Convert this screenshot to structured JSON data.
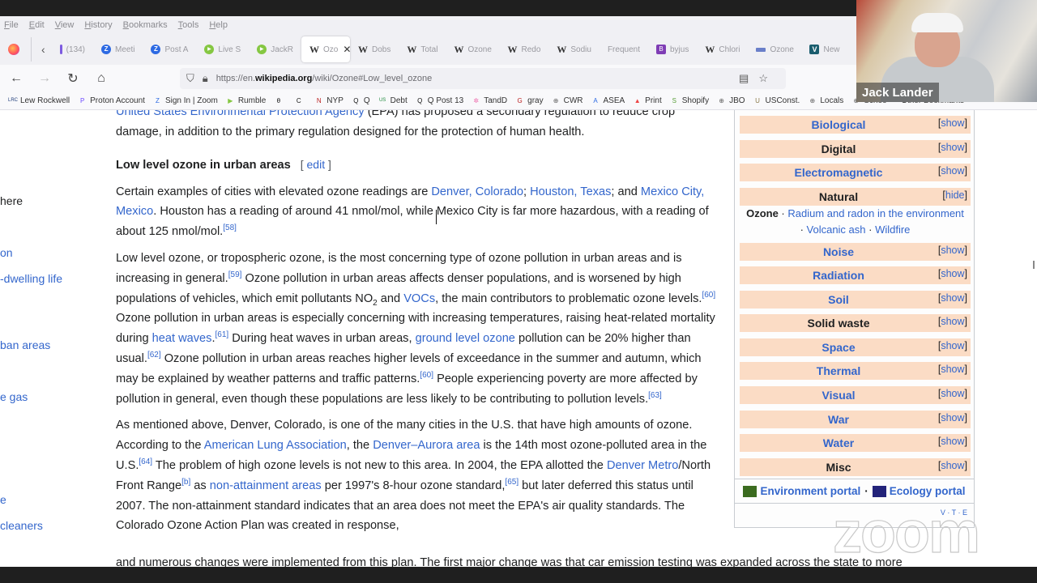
{
  "browser": {
    "menu": [
      "File",
      "Edit",
      "View",
      "History",
      "Bookmarks",
      "Tools",
      "Help"
    ],
    "tabs": [
      {
        "label": "(134)",
        "icon": "bar"
      },
      {
        "label": "Meeti",
        "icon": "zoom"
      },
      {
        "label": "Post A",
        "icon": "zoom"
      },
      {
        "label": "Live S",
        "icon": "rumble"
      },
      {
        "label": "JackR",
        "icon": "rumble"
      },
      {
        "label": "Ozo",
        "icon": "wiki",
        "active": true
      },
      {
        "label": "Dobs",
        "icon": "wiki"
      },
      {
        "label": "Total",
        "icon": "wiki"
      },
      {
        "label": "Ozone",
        "icon": "wiki"
      },
      {
        "label": "Redo",
        "icon": "wiki"
      },
      {
        "label": "Sodiu",
        "icon": "wiki"
      },
      {
        "label": "Frequent",
        "icon": "none"
      },
      {
        "label": "byjus",
        "icon": "purple"
      },
      {
        "label": "Chlori",
        "icon": "wiki"
      },
      {
        "label": "Ozone",
        "icon": "blue"
      },
      {
        "label": "New",
        "icon": "v"
      }
    ],
    "url_prefix": "https://en.",
    "url_domain": "wikipedia.org",
    "url_suffix": "/wiki/Ozone#Low_level_ozone",
    "bookmarks": [
      {
        "label": "Lew Rockwell",
        "icon": "LRC"
      },
      {
        "label": "Proton Account",
        "icon": "P"
      },
      {
        "label": "Sign In | Zoom",
        "icon": "Z"
      },
      {
        "label": "Rumble",
        "icon": "▶"
      },
      {
        "label": "",
        "icon": "θ"
      },
      {
        "label": "",
        "icon": "C"
      },
      {
        "label": "NYP",
        "icon": "N"
      },
      {
        "label": "Q",
        "icon": "Q"
      },
      {
        "label": "Debt",
        "icon": "US"
      },
      {
        "label": "Q Post 13",
        "icon": "Q"
      },
      {
        "label": "TandD",
        "icon": "✲"
      },
      {
        "label": "gray",
        "icon": "G"
      },
      {
        "label": "CWR",
        "icon": "⊕"
      },
      {
        "label": "ASEA",
        "icon": "A"
      },
      {
        "label": "Print",
        "icon": "▲"
      },
      {
        "label": "Shopify",
        "icon": "S"
      },
      {
        "label": "JBO",
        "icon": "⊕"
      },
      {
        "label": "USConst.",
        "icon": "U"
      },
      {
        "label": "Locals",
        "icon": "⊕"
      },
      {
        "label": "Schoo",
        "icon": "⊕"
      }
    ],
    "other_bookmarks": "Other Bookmarks"
  },
  "toc": [
    {
      "label": "here",
      "current": true
    },
    {
      "label": "on"
    },
    {
      "label": "-dwelling life"
    },
    {
      "label": "ban areas"
    },
    {
      "label": "e gas"
    },
    {
      "label": "e"
    },
    {
      "label": "cleaners"
    }
  ],
  "article": {
    "intro_link": "United States Environmental Protection Agency",
    "intro_text": " (EPA) has proposed a secondary regulation to reduce crop damage, in addition to the primary regulation designed for the protection of human health.",
    "heading": "Low level ozone in urban areas",
    "edit_label": "edit",
    "p1": {
      "t1": "Certain examples of cities with elevated ozone readings are ",
      "l1": "Denver, Colorado",
      "t2": "; ",
      "l2": "Houston, Texas",
      "t3": "; and ",
      "l3": "Mexico City, Mexico",
      "t4": ". Houston has a reading of around 41 nmol/mol, while Mexico City is far more hazardous, with a reading of about 125 nmol/mol.",
      "ref1": "[58]"
    },
    "p2": {
      "t1": "Low level ozone, or tropospheric ozone, is the most concerning type of ozone pollution in urban areas and is increasing in general.",
      "ref1": "[59]",
      "t2": " Ozone pollution in urban areas affects denser populations, and is worsened by high populations of vehicles, which emit pollutants NO",
      "sub": "2",
      "t3": " and ",
      "l1": "VOCs",
      "t4": ", the main contributors to problematic ozone levels.",
      "ref2": "[60]",
      "t5": " Ozone pollution in urban areas is especially concerning with increasing temperatures, raising heat-related mortality during ",
      "l2": "heat waves",
      "t6": ".",
      "ref3": "[61]",
      "t7": " During heat waves in urban areas, ",
      "l3": "ground level ozone",
      "t8": " pollution can be 20% higher than usual.",
      "ref4": "[62]",
      "t9": " Ozone pollution in urban areas reaches higher levels of exceedance in the summer and autumn, which may be explained by weather patterns and traffic patterns.",
      "ref5": "[60]",
      "t10": " People experiencing poverty are more affected by pollution in general, even though these populations are less likely to be contributing to pollution levels.",
      "ref6": "[63]"
    },
    "p3": {
      "t1": "As mentioned above, Denver, Colorado, is one of the many cities in the U.S. that have high amounts of ozone. According to the ",
      "l1": "American Lung Association",
      "t2": ", the ",
      "l2": "Denver–Aurora area",
      "t3": " is the 14th most ozone-polluted area in the U.S.",
      "ref1": "[64]",
      "t4": " The problem of high ozone levels is not new to this area. In 2004, the EPA allotted the ",
      "l3": "Denver Metro",
      "t5": "/North Front Range",
      "ref2": "[b]",
      "t6": " as ",
      "l4": "non-attainment areas",
      "t7": " per 1997's 8-hour ozone standard,",
      "ref3": "[65]",
      "t8": " but later deferred this status until 2007. The non-attainment standard indicates that an area does not meet the EPA's air quality standards. The Colorado Ozone Action Plan was created in response,"
    },
    "cutoff": "and numerous changes were implemented from this plan. The first major change was that car emission testing was expanded across the state to more"
  },
  "navbox": {
    "groups": [
      {
        "title": "Biological",
        "toggle": "show",
        "link": true
      },
      {
        "title": "Digital",
        "toggle": "show",
        "link": false
      },
      {
        "title": "Electromagnetic",
        "toggle": "show",
        "link": true
      },
      {
        "title": "Natural",
        "toggle": "hide",
        "link": false
      },
      {
        "title": "Noise",
        "toggle": "show",
        "link": true
      },
      {
        "title": "Radiation",
        "toggle": "show",
        "link": true
      },
      {
        "title": "Soil",
        "toggle": "show",
        "link": true
      },
      {
        "title": "Solid waste",
        "toggle": "show",
        "link": false
      },
      {
        "title": "Space",
        "toggle": "show",
        "link": true
      },
      {
        "title": "Thermal",
        "toggle": "show",
        "link": true
      },
      {
        "title": "Visual",
        "toggle": "show",
        "link": true
      },
      {
        "title": "War",
        "toggle": "show",
        "link": true
      },
      {
        "title": "Water",
        "toggle": "show",
        "link": true
      },
      {
        "title": "Misc",
        "toggle": "show",
        "link": false
      }
    ],
    "natural_items": {
      "current": "Ozone",
      "i1": "Radium and radon in the environment",
      "i2": "Volcanic ash",
      "i3": "Wildfire"
    },
    "portal1": "Environment portal",
    "portal2": "Ecology portal",
    "vte": "V · T · E"
  },
  "webcam": {
    "name": "Jack Lander"
  },
  "watermark": "zoom"
}
